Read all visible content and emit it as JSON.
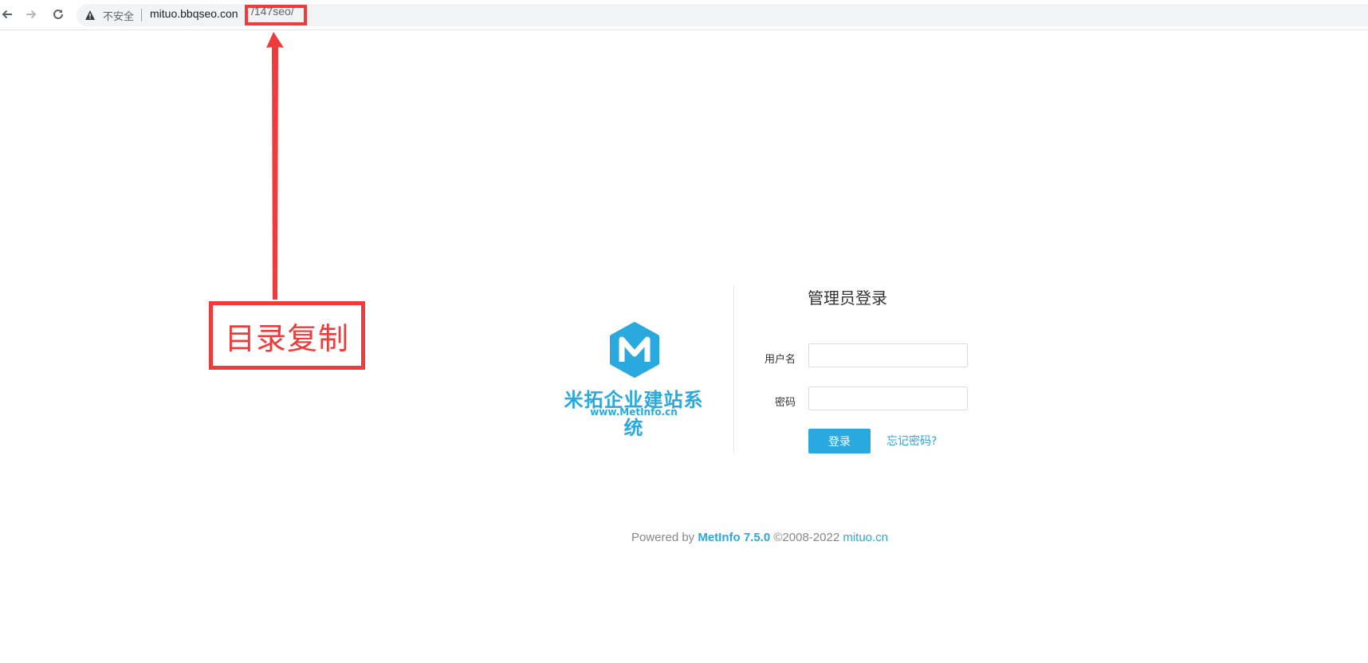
{
  "browser": {
    "security_text": "不安全",
    "url_host": "mituo.bbqseo.con",
    "url_path": "/147seo/"
  },
  "annotation": {
    "text": "目录复制",
    "color": "#ef3b3b"
  },
  "logo": {
    "letter": "M",
    "title": "米拓企业建站系统",
    "url": "www.MetInfo.cn"
  },
  "login": {
    "title": "管理员登录",
    "username_label": "用户名",
    "username_value": "",
    "password_label": "密码",
    "password_value": "",
    "submit_label": "登录",
    "forgot_label": "忘记密码?"
  },
  "footer": {
    "prefix": "Powered by ",
    "brand": "MetInfo 7.5.0",
    "copyright": " ©2008-2022 ",
    "site": "mituo.cn"
  },
  "colors": {
    "accent": "#2aa8e0",
    "annotation": "#ef3b3b"
  }
}
